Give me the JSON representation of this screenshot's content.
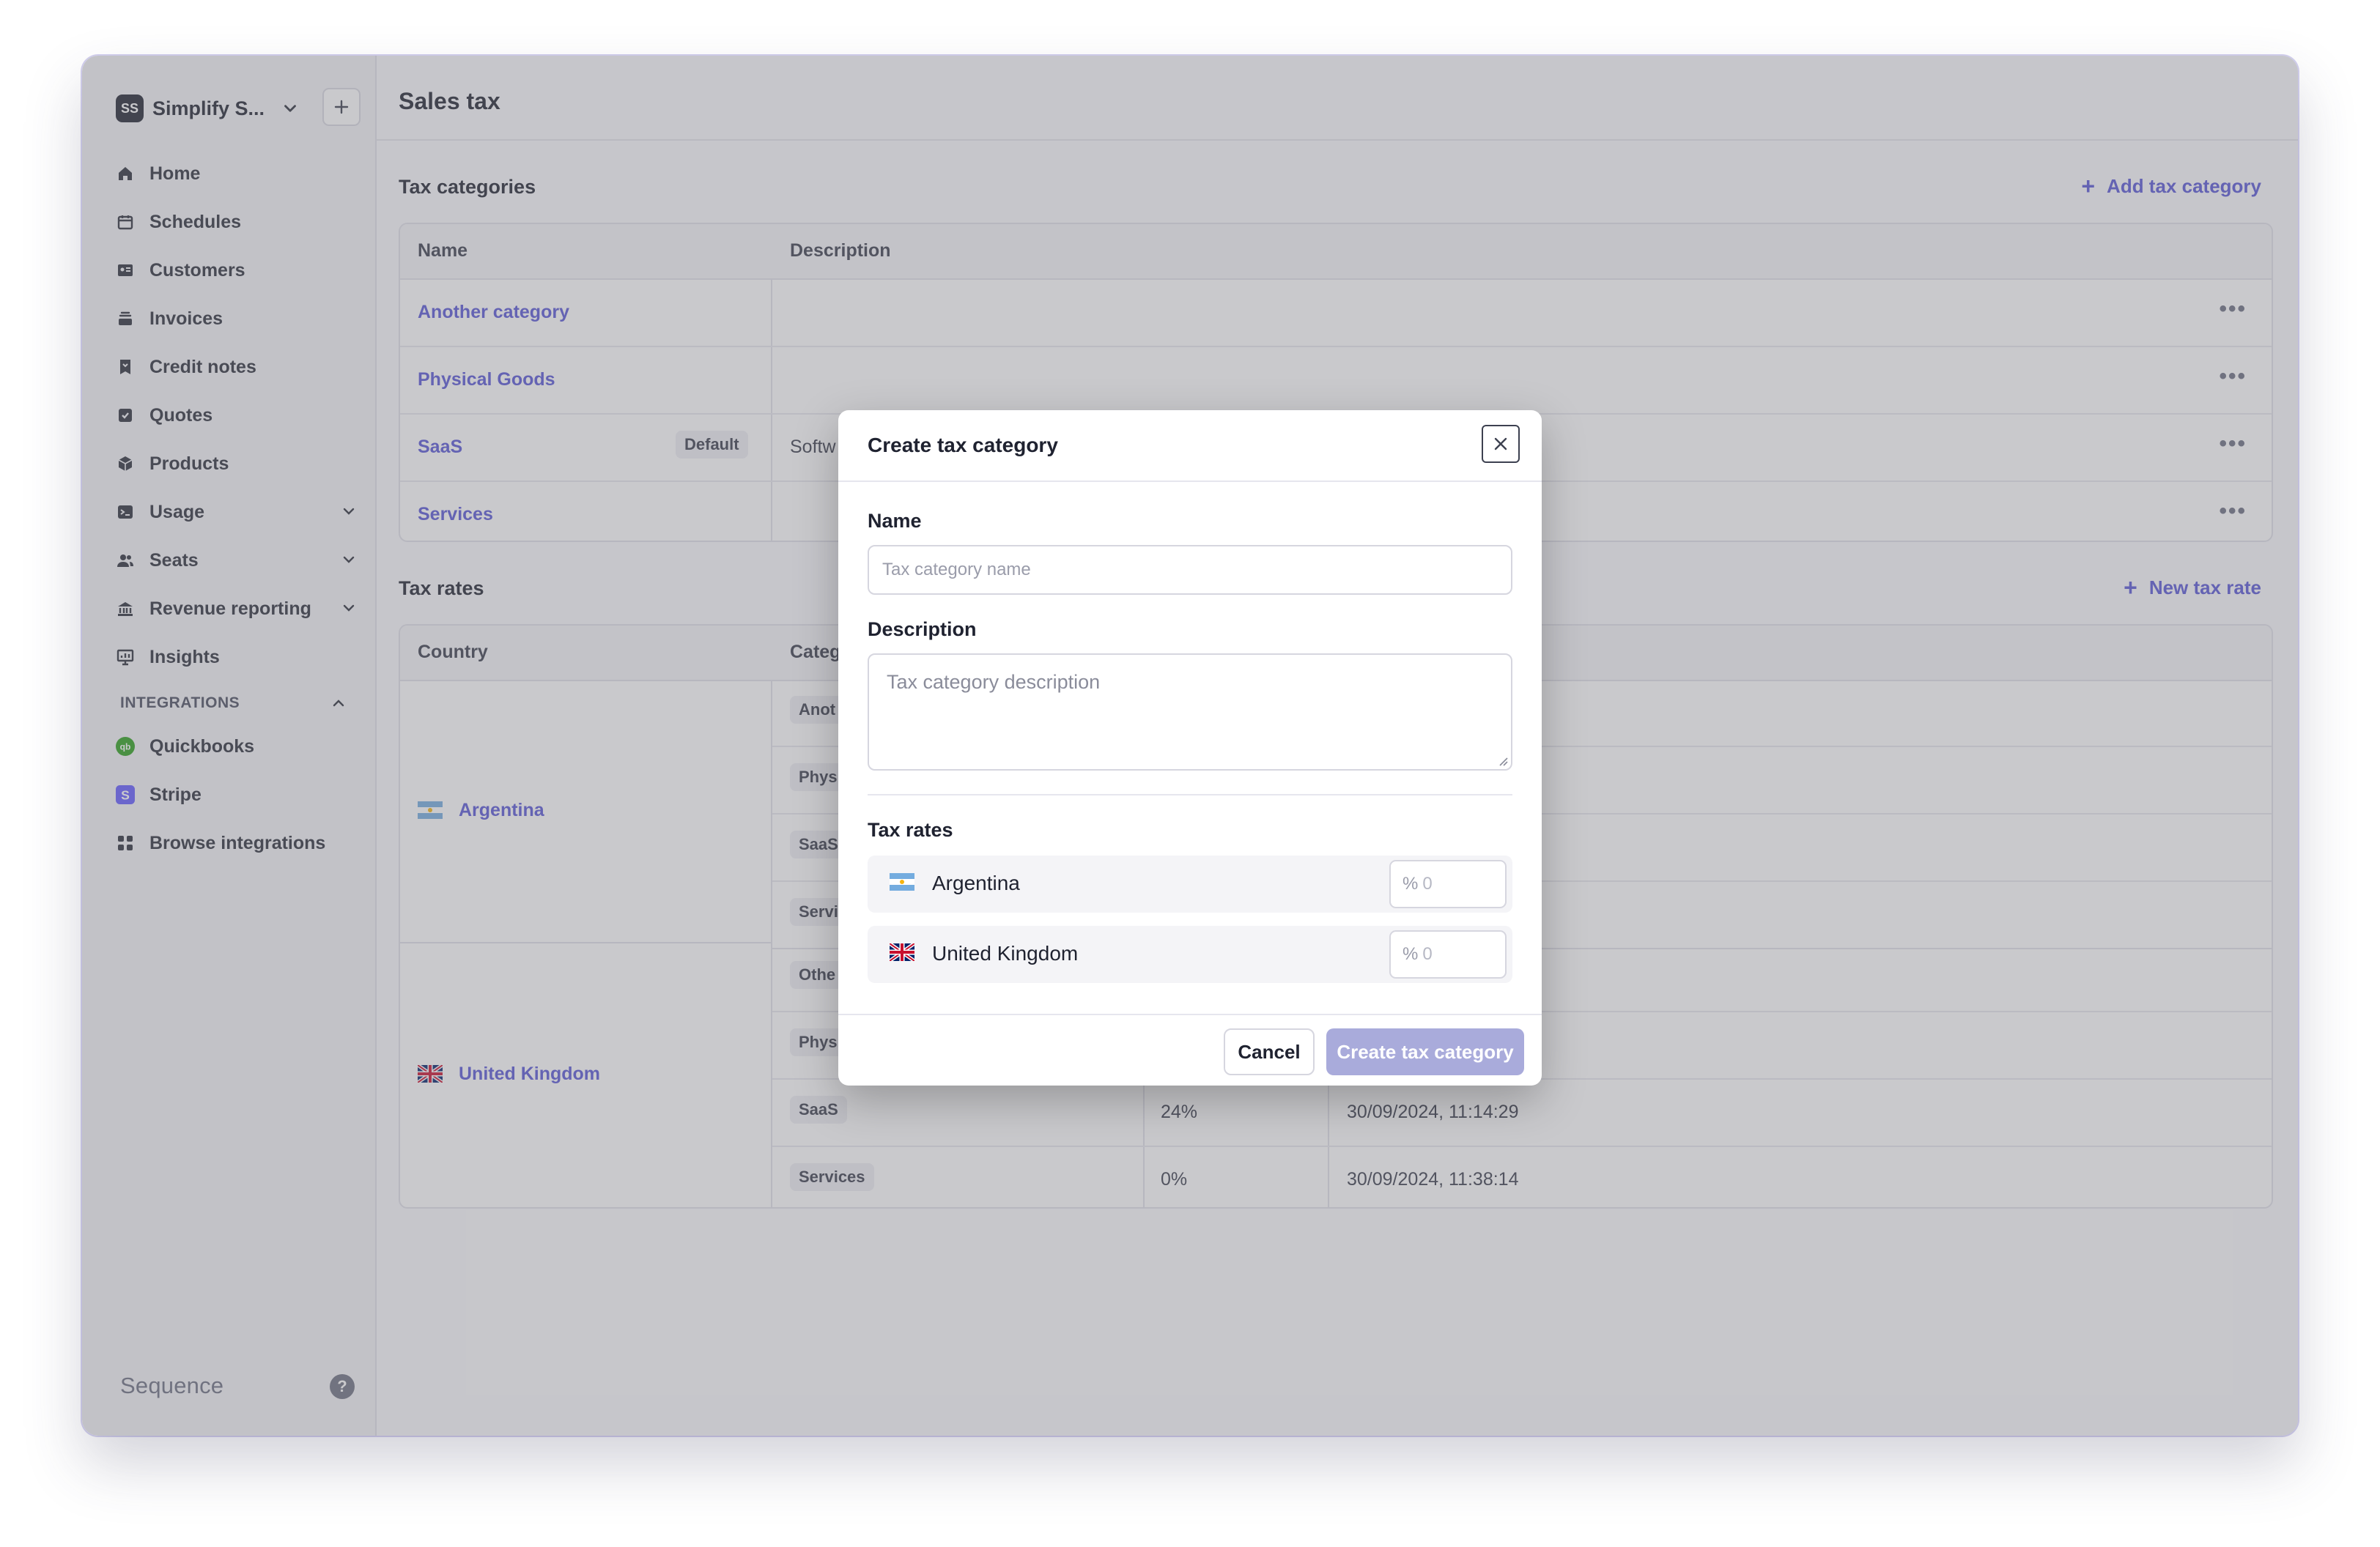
{
  "workspace": {
    "avatar": "SS",
    "name": "Simplify S..."
  },
  "sidebar": {
    "items": [
      {
        "label": "Home",
        "icon": "home-icon"
      },
      {
        "label": "Schedules",
        "icon": "calendar-icon"
      },
      {
        "label": "Customers",
        "icon": "contact-card-icon"
      },
      {
        "label": "Invoices",
        "icon": "stack-icon"
      },
      {
        "label": "Credit notes",
        "icon": "credit-note-icon"
      },
      {
        "label": "Quotes",
        "icon": "check-doc-icon"
      },
      {
        "label": "Products",
        "icon": "cube-icon"
      },
      {
        "label": "Usage",
        "icon": "terminal-icon",
        "expandable": true
      },
      {
        "label": "Seats",
        "icon": "users-icon",
        "expandable": true
      },
      {
        "label": "Revenue reporting",
        "icon": "bank-icon",
        "expandable": true
      },
      {
        "label": "Insights",
        "icon": "presentation-chart-icon"
      }
    ],
    "integrations_label": "INTEGRATIONS",
    "integrations": [
      {
        "label": "Quickbooks",
        "icon": "quickbooks-icon"
      },
      {
        "label": "Stripe",
        "icon": "stripe-icon"
      },
      {
        "label": "Browse integrations",
        "icon": "grid-icon"
      }
    ],
    "brand": "Sequence",
    "help": "?"
  },
  "page": {
    "title": "Sales tax",
    "categories": {
      "title": "Tax categories",
      "action": "Add tax category",
      "headers": [
        "Name",
        "Description"
      ],
      "rows": [
        {
          "name": "Another category",
          "badge": "",
          "description": ""
        },
        {
          "name": "Physical Goods",
          "badge": "",
          "description": ""
        },
        {
          "name": "SaaS",
          "badge": "Default",
          "description": "Softw"
        },
        {
          "name": "Services",
          "badge": "",
          "description": ""
        }
      ]
    },
    "rates": {
      "title": "Tax rates",
      "action": "New tax rate",
      "headers": [
        "Country",
        "Categ"
      ],
      "argentina": {
        "country": "Argentina",
        "rows": [
          {
            "category": "Anot",
            "rate": "",
            "date": ""
          },
          {
            "category": "Phys",
            "rate": "",
            "date": ""
          },
          {
            "category": "SaaS",
            "rate": "",
            "date": ""
          },
          {
            "category": "Servi",
            "rate": "",
            "date": ""
          }
        ]
      },
      "uk": {
        "country": "United Kingdom",
        "rows": [
          {
            "category": "Othe",
            "rate": "",
            "date": ""
          },
          {
            "category": "Phys",
            "rate": "",
            "date": ""
          },
          {
            "category": "SaaS",
            "rate": "24%",
            "date": "30/09/2024, 11:14:29"
          },
          {
            "category": "Services",
            "rate": "0%",
            "date": "30/09/2024, 11:38:14"
          }
        ]
      }
    }
  },
  "modal": {
    "title": "Create tax category",
    "name_label": "Name",
    "name_placeholder": "Tax category name",
    "description_label": "Description",
    "description_placeholder": "Tax category description",
    "rates_label": "Tax rates",
    "rates": [
      {
        "country": "Argentina",
        "prefix": "%",
        "placeholder": "0"
      },
      {
        "country": "United Kingdom",
        "prefix": "%",
        "placeholder": "0"
      }
    ],
    "cancel": "Cancel",
    "submit": "Create tax category"
  },
  "colors": {
    "accent": "#5856d6",
    "overlay": "rgba(120,120,128,0.4)",
    "submit_disabled": "#a9abdb"
  }
}
